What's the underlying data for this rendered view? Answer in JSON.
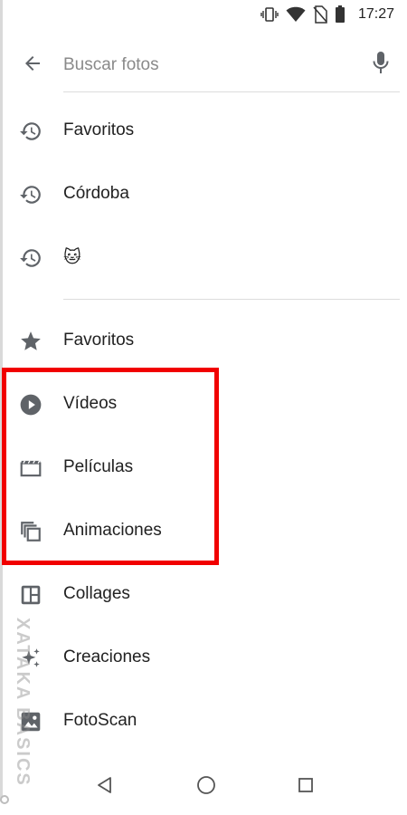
{
  "status_bar": {
    "time": "17:27",
    "icons": [
      "vibrate-icon",
      "wifi-icon",
      "no-sim-icon",
      "battery-icon"
    ]
  },
  "search": {
    "placeholder": "Buscar fotos",
    "value": ""
  },
  "recent_searches": [
    {
      "icon": "history-icon",
      "label": "Favoritos"
    },
    {
      "icon": "history-icon",
      "label": "Córdoba"
    },
    {
      "icon": "history-icon",
      "label": "🐱"
    }
  ],
  "categories": [
    {
      "icon": "star-icon",
      "label": "Favoritos"
    },
    {
      "icon": "play-circle-icon",
      "label": "Vídeos"
    },
    {
      "icon": "movie-icon",
      "label": "Películas"
    },
    {
      "icon": "animation-icon",
      "label": "Animaciones"
    },
    {
      "icon": "collage-icon",
      "label": "Collages"
    },
    {
      "icon": "sparkle-icon",
      "label": "Creaciones"
    },
    {
      "icon": "photoscan-icon",
      "label": "FotoScan"
    }
  ],
  "watermark": "XATAKA BASICS",
  "colors": {
    "highlight": "#f10000",
    "icon": "#5f6368",
    "text": "#212121"
  }
}
